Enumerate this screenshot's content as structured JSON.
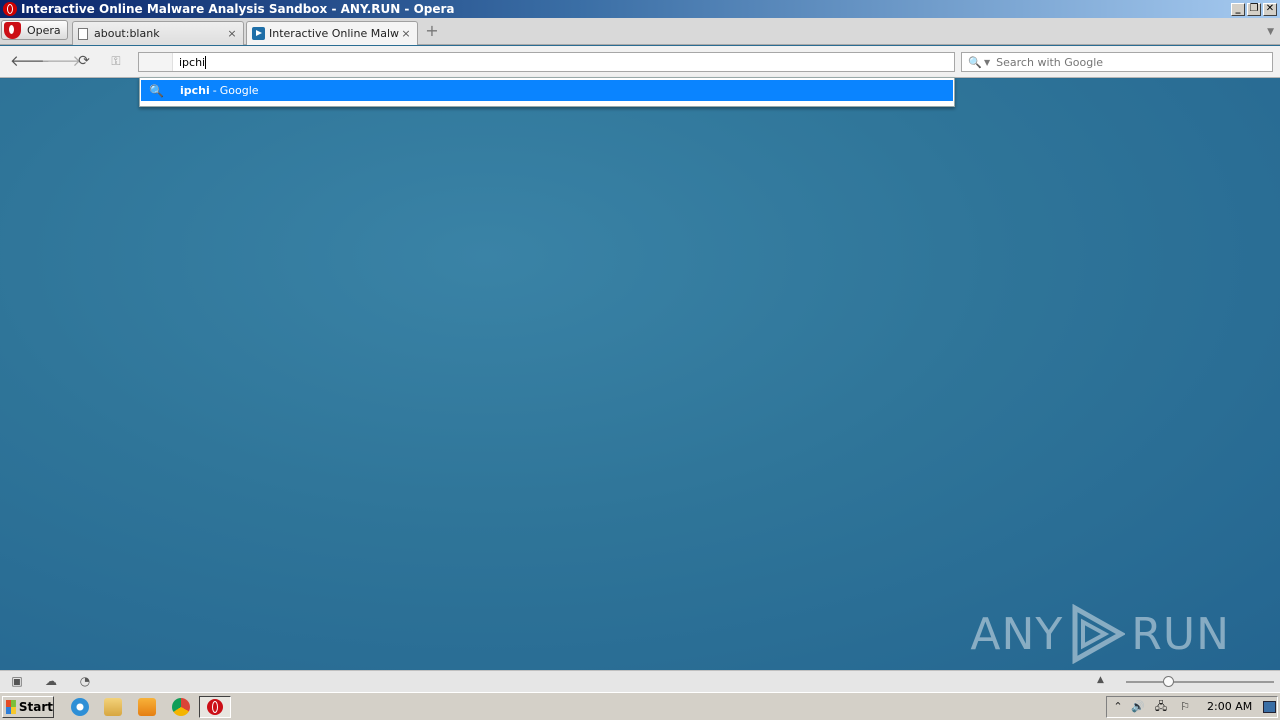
{
  "window": {
    "title": "Interactive Online Malware Analysis Sandbox - ANY.RUN - Opera",
    "minimize": "_",
    "restore": "❐",
    "close": "✕"
  },
  "tabbar": {
    "menu_label": "Opera",
    "tabs": [
      {
        "label": "about:blank",
        "close": "×"
      },
      {
        "label": "Interactive Online Malwa...",
        "close": "×"
      }
    ],
    "new_tab": "+",
    "tab_menu": "▼"
  },
  "toolbar": {
    "back": "🡐",
    "forward": "🡒",
    "reload": "⟳",
    "key": "⚿",
    "address_value": "ipchi",
    "search_placeholder": "Search with Google",
    "search_icon": "🔍",
    "search_dropdown": "▼"
  },
  "dropdown": {
    "items": [
      {
        "term": "ipchi",
        "separator": "-",
        "engine": "Google",
        "icon": "🔍"
      }
    ]
  },
  "watermark": {
    "left": "ANY",
    "right": "RUN"
  },
  "statusbar": {
    "panel_icon": "▣",
    "cloud_icon": "☁",
    "speed_icon": "◔",
    "up_arrow": "▲",
    "zoom_level": 0.29
  },
  "taskbar": {
    "start_label": "Start",
    "clock": "2:00 AM",
    "tray_up": "⌃",
    "volume_icon": "🔊",
    "network_icon": "🖧",
    "flag_icon": "⚐"
  },
  "colors": {
    "accent": "#0a84ff",
    "desktop": "#2a6d93",
    "opera_red": "#cc0f16"
  }
}
